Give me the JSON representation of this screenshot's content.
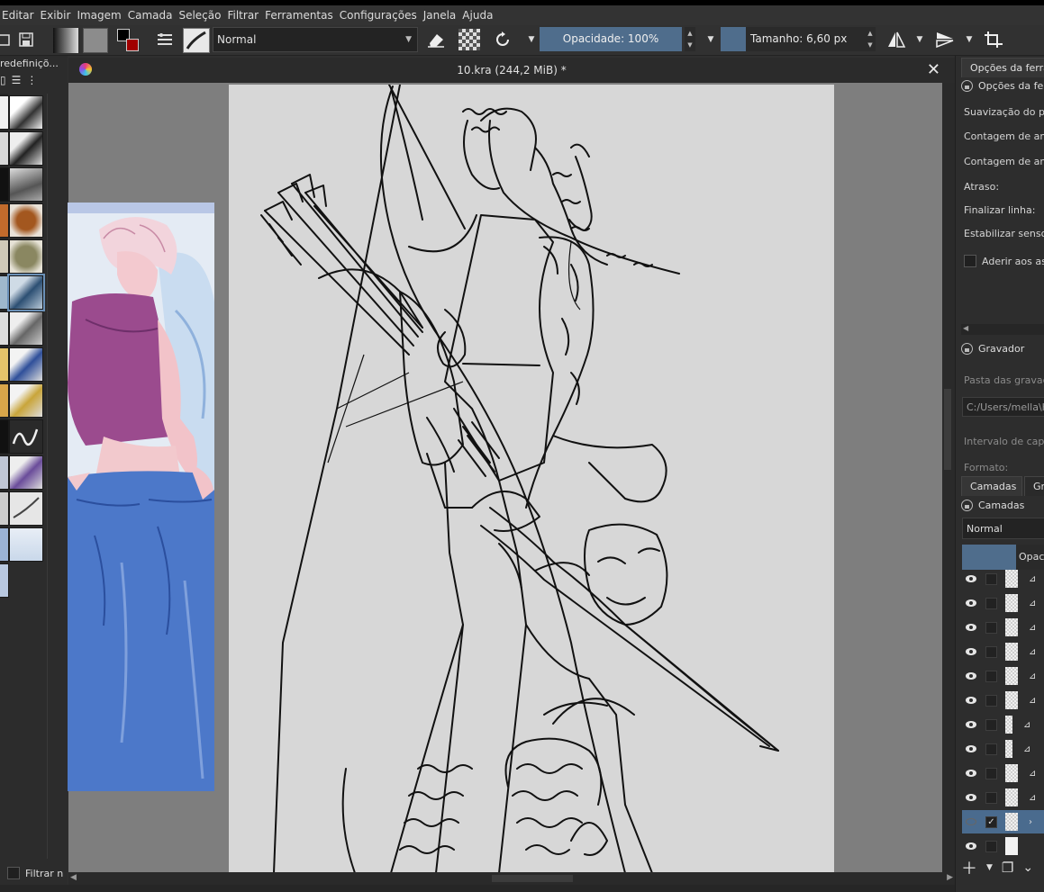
{
  "menu": [
    "Editar",
    "Exibir",
    "Imagem",
    "Camada",
    "Seleção",
    "Filtrar",
    "Ferramentas",
    "Configurações",
    "Janela",
    "Ajuda"
  ],
  "toolbar": {
    "blend_mode": "Normal",
    "opacity_label": "Opacidade: 100%",
    "size_label": "Tamanho: 6,60 px"
  },
  "brush_presets": {
    "title": "redefiniçõ...",
    "filter_label": "Filtrar n"
  },
  "document": {
    "title": "10.kra (244,2 MiB) *"
  },
  "tool_options": {
    "tab": "Opções da ferra",
    "header": "Opções da ferr",
    "rows": [
      "Suavização do pir",
      "Contagem de amo",
      "Contagem de amo",
      "Atraso:",
      "Finalizar linha:",
      "Estabilizar sensor"
    ],
    "assist_checkbox": "Aderir aos ass"
  },
  "recorder": {
    "header": "Gravador",
    "folder_label": "Pasta das gravaçõ",
    "folder_path": "C:/Users/mella\\Kr",
    "interval_label": "Intervalo de captu",
    "format_label": "Formato:"
  },
  "layers": {
    "tab_layers": "Camadas",
    "tab_other": "Gr",
    "header": "Camadas",
    "blend_mode": "Normal",
    "opacity_label": "Opac"
  },
  "colors": {
    "accent": "#4f6d8c",
    "selected_layer": "#4a6b8e",
    "paper": "#d7d7d7",
    "canvas_bg": "#7e7e7e"
  }
}
